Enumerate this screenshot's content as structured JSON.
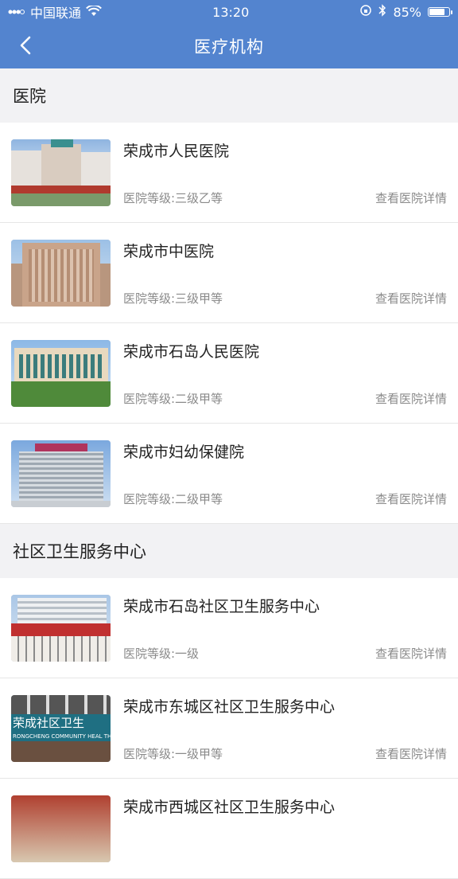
{
  "status_bar": {
    "carrier": "中国联通",
    "time": "13:20",
    "battery": "85%",
    "battery_level": 0.85
  },
  "nav": {
    "title": "医疗机构",
    "back_icon": "chevron-left-icon"
  },
  "sections": [
    {
      "title": "医院",
      "items": [
        {
          "name": "荣成市人民医院",
          "grade": "医院等级:三级乙等",
          "detail": "查看医院详情"
        },
        {
          "name": "荣成市中医院",
          "grade": "医院等级:三级甲等",
          "detail": "查看医院详情"
        },
        {
          "name": "荣成市石岛人民医院",
          "grade": "医院等级:二级甲等",
          "detail": "查看医院详情"
        },
        {
          "name": "荣成市妇幼保健院",
          "grade": "医院等级:二级甲等",
          "detail": "查看医院详情"
        }
      ]
    },
    {
      "title": "社区卫生服务中心",
      "items": [
        {
          "name": "荣成市石岛社区卫生服务中心",
          "grade": "医院等级:一级",
          "detail": "查看医院详情"
        },
        {
          "name": "荣成市东城区社区卫生服务中心",
          "grade": "医院等级:一级甲等",
          "detail": "查看医院详情"
        },
        {
          "name": "荣成市西城区社区卫生服务中心",
          "grade": "",
          "detail": ""
        }
      ]
    }
  ],
  "image_signs": {
    "community_sign": "荣成社区卫生",
    "community_sign_en": "RONGCHENG COMMUNITY HEAL TH"
  }
}
